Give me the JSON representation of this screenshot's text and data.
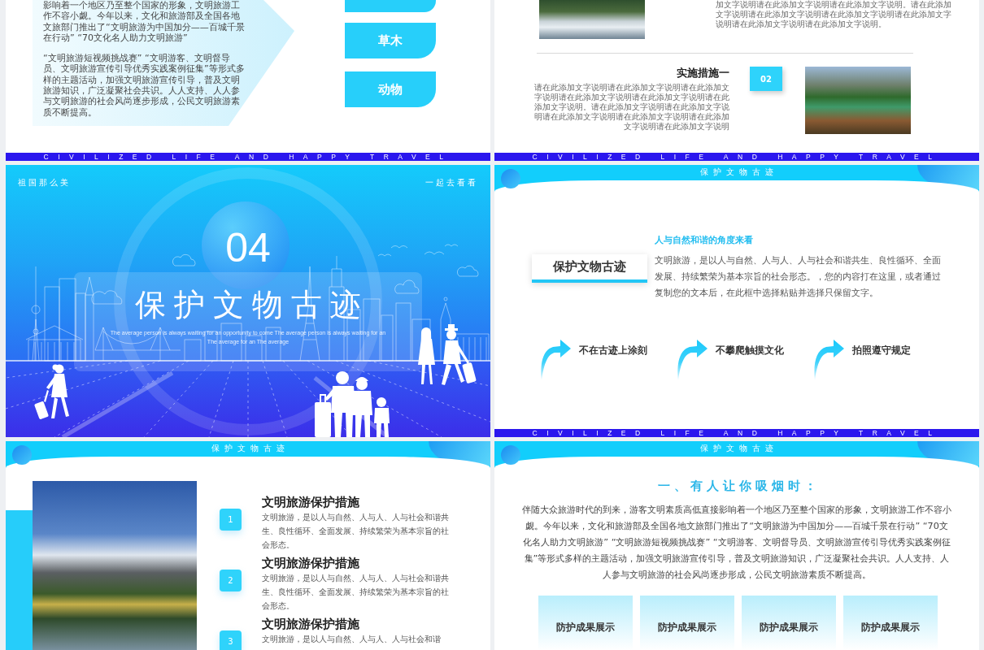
{
  "intro_slide": {
    "paragraphs": [
      "影响着一个地区乃至整个国家的形象，文明旅游工作不容小觑。今年以来，文化和旅游部及全国各地文旅部门推出了“文明旅游为中国加分——百城千景在行动” “70文化名人助力文明旅游”",
      "“文明旅游短视频挑战赛” “文明游客、文明督导员、文明旅游宣传引导优秀实践案例征集”等形式多样的主题活动，加强文明旅游宣传引导，普及文明旅游知识，广泛凝聚社会共识。人人支持、人人参与文明旅游的社会风尚逐步形成，公民文明旅游素质不断提高。"
    ],
    "tabs": [
      {
        "label": "草木"
      },
      {
        "label": "动物"
      }
    ],
    "footer": "CIVILIZED LIFE AND HAPPY TRAVEL"
  },
  "measure_slide": {
    "upper_text": "加文字说明请在此添加文字说明请在此添加文字说明。请在此添加文字说明请在此添加文字说明请在此添加文字说明请在此添加文字说明请在此添加文字说明请在此添加文字说明。",
    "measure": {
      "title": "实施措施一",
      "body": "请在此添加文字说明请在此添加文字说明请在此添加文字说明请在此添加文字说明请在此添加文字说明请在此添加文字说明。请在此添加文字说明请在此添加文字说明请在此添加文字说明请在此添加文字说明请在此添加文字说明请在此添加文字说明",
      "number": "02"
    },
    "footer": "CIVILIZED LIFE AND HAPPY TRAVEL"
  },
  "cover_slide": {
    "corner_left": "祖国那么美",
    "corner_right": "一起去看看",
    "number": "04",
    "title": "保护文物古迹",
    "subtitle": "The average person is always waiting for an opportunity to come The average person is always waiting for an The average for an The average"
  },
  "heritage_slide": {
    "header": "保护文物古迹",
    "topic": "保护文物古迹",
    "heading": "人与自然和谐的角度来看",
    "body": "文明旅游，是以人与自然、人与人、人与社会和谐共生、良性循环、全面发展、持续繁荣为基本宗旨的社会形态。，您的内容打在这里，或者通过复制您的文本后，在此框中选择粘贴并选择只保留文字。",
    "rules": [
      {
        "label": "不在古迹上涂刻"
      },
      {
        "label": "不攀爬触摸文化"
      },
      {
        "label": "拍照遵守规定"
      }
    ],
    "footer": "CIVILIZED LIFE AND HAPPY TRAVEL"
  },
  "steps_slide": {
    "header": "保护文物古迹",
    "items": [
      {
        "number": "1",
        "title": "文明旅游保护措施",
        "body": "文明旅游，是以人与自然、人与人、人与社会和谐共生、良性循环、全面发展、持续繁荣为基本宗旨的社会形态。"
      },
      {
        "number": "2",
        "title": "文明旅游保护措施",
        "body": "文明旅游，是以人与自然、人与人、人与社会和谐共生、良性循环、全面发展、持续繁荣为基本宗旨的社会形态。"
      },
      {
        "number": "3",
        "title": "文明旅游保护措施",
        "body": "文明旅游，是以人与自然、人与人、人与社会和谐"
      }
    ]
  },
  "article_slide": {
    "header": "保护文物古迹",
    "title": "一、有人让你吸烟时：",
    "body": "伴随大众旅游时代的到来，游客文明素质高低直接影响着一个地区乃至整个国家的形象，文明旅游工作不容小觑。今年以来，文化和旅游部及全国各地文旅部门推出了“文明旅游为中国加分——百城千景在行动” “70文化名人助力文明旅游” “文明旅游短视频挑战赛” “文明游客、文明督导员、文明旅游宣传引导优秀实践案例征集”等形式多样的主题活动，加强文明旅游宣传引导，普及文明旅游知识，广泛凝聚社会共识。人人支持、人人参与文明旅游的社会风尚逐步形成，公民文明旅游素质不断提高。",
    "cards": [
      {
        "label": "防护成果展示"
      },
      {
        "label": "防护成果展示"
      },
      {
        "label": "防护成果展示"
      },
      {
        "label": "防护成果展示"
      }
    ]
  }
}
